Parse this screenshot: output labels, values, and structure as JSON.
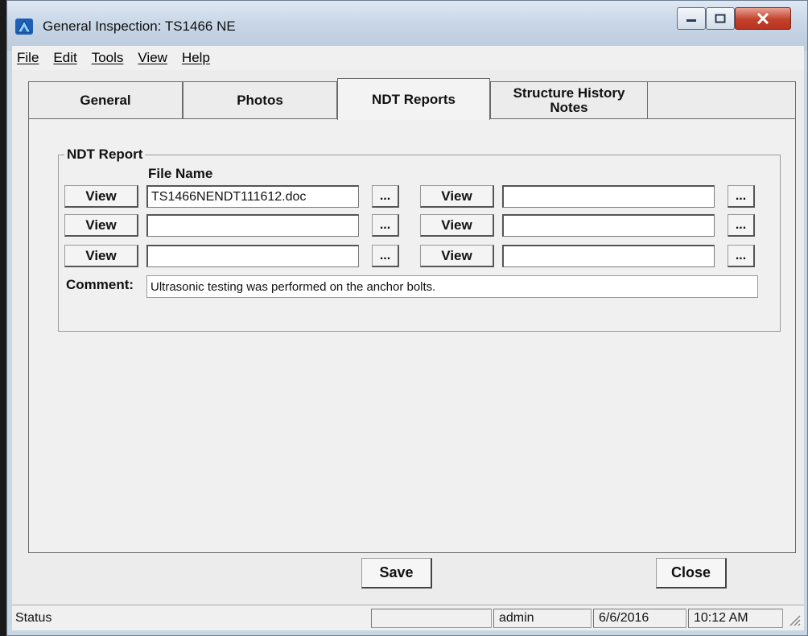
{
  "window": {
    "title": "General Inspection: TS1466 NE",
    "minimize_icon": "minimize-icon",
    "maximize_icon": "maximize-icon",
    "close_icon": "close-icon"
  },
  "menu": {
    "items": [
      "File",
      "Edit",
      "Tools",
      "View",
      "Help"
    ]
  },
  "tabs": [
    {
      "label": "General",
      "active": false
    },
    {
      "label": "Photos",
      "active": false
    },
    {
      "label": "NDT Reports",
      "active": true
    },
    {
      "label": "Structure History Notes",
      "active": false
    }
  ],
  "ndt": {
    "group_label": "NDT Report",
    "file_name_header": "File Name",
    "view_label": "View",
    "browse_label": "...",
    "files": [
      {
        "left": "TS1466NENDT111612.doc",
        "right": ""
      },
      {
        "left": "",
        "right": ""
      },
      {
        "left": "",
        "right": ""
      }
    ],
    "comment_label": "Comment:",
    "comment_value": "Ultrasonic testing was performed on the anchor bolts."
  },
  "actions": {
    "save_label": "Save",
    "close_label": "Close"
  },
  "statusbar": {
    "status_text": "Status",
    "field_empty": "",
    "user": "admin",
    "date": "6/6/2016",
    "time": "10:12 AM"
  },
  "colors": {
    "close_button": "#c1412c",
    "panel_bg": "#f0f0f0"
  }
}
